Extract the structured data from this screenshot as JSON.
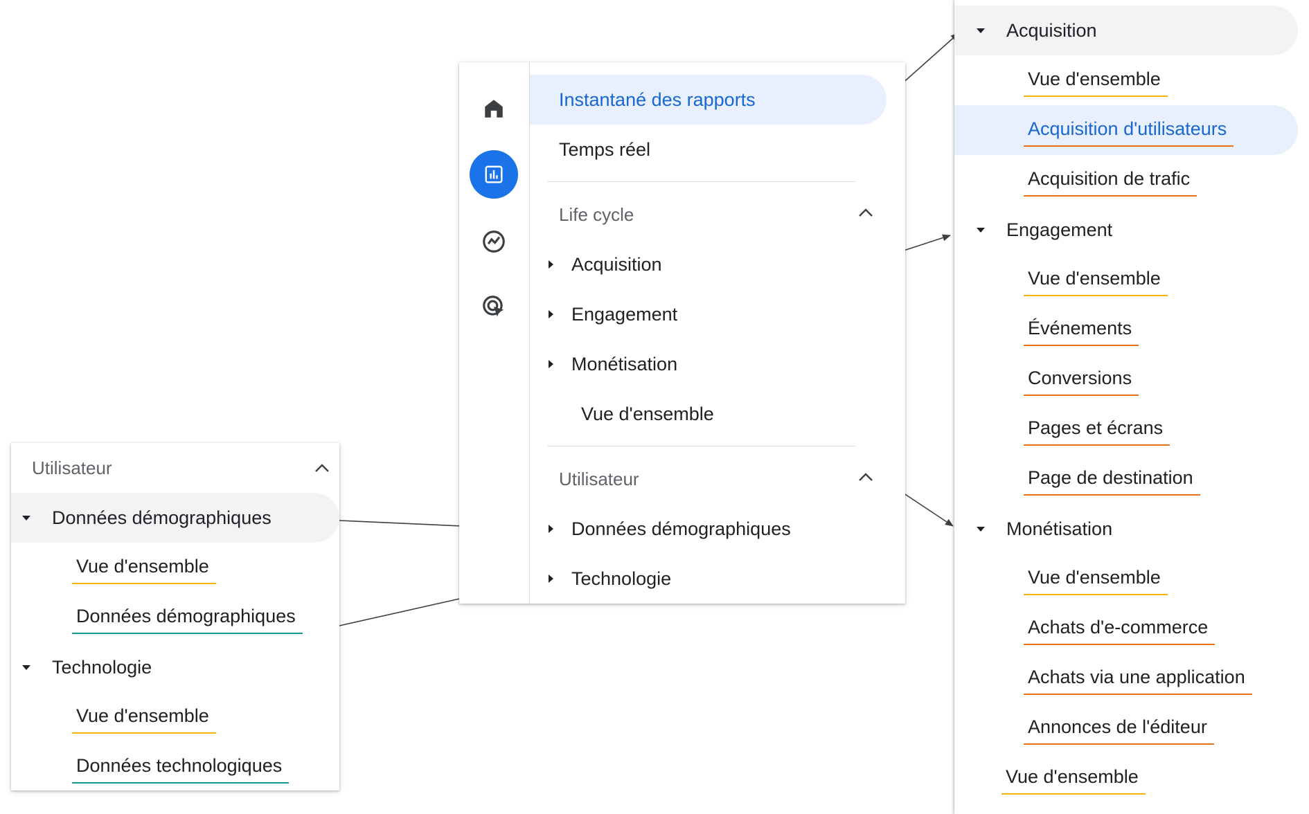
{
  "center": {
    "rail": {
      "icons": [
        "home-icon",
        "reports-icon",
        "explore-icon",
        "advertising-icon"
      ],
      "accent": "#1a73e8"
    },
    "items": {
      "snapshot": "Instantané des rapports",
      "realtime": "Temps réel"
    },
    "lifecycle": {
      "label": "Life cycle",
      "items": [
        "Acquisition",
        "Engagement",
        "Monétisation"
      ],
      "overview": "Vue d'ensemble"
    },
    "user": {
      "label": "Utilisateur",
      "items": [
        "Données démographiques",
        "Technologie"
      ]
    }
  },
  "right": {
    "acquisition": {
      "title": "Acquisition",
      "items": [
        "Vue d'ensemble",
        "Acquisition d'utilisateurs",
        "Acquisition de trafic"
      ]
    },
    "engagement": {
      "title": "Engagement",
      "items": [
        "Vue d'ensemble",
        "Événements",
        "Conversions",
        "Pages et écrans",
        "Page de destination"
      ]
    },
    "monetisation": {
      "title": "Monétisation",
      "items": [
        "Vue d'ensemble",
        "Achats d'e-commerce",
        "Achats via une application",
        "Annonces de l'éditeur"
      ]
    },
    "overview": "Vue d'ensemble"
  },
  "left": {
    "header": "Utilisateur",
    "demographics": {
      "title": "Données démographiques",
      "items": [
        "Vue d'ensemble",
        "Données démographiques"
      ]
    },
    "technology": {
      "title": "Technologie",
      "items": [
        "Vue d'ensemble",
        "Données technologiques"
      ]
    }
  },
  "colors": {
    "selected_bg": "#e8f0fe",
    "selected_text": "#1967d2",
    "underline_orange": "#e8711a",
    "underline_yellow": "#f4b400",
    "underline_teal": "#129a8f"
  }
}
